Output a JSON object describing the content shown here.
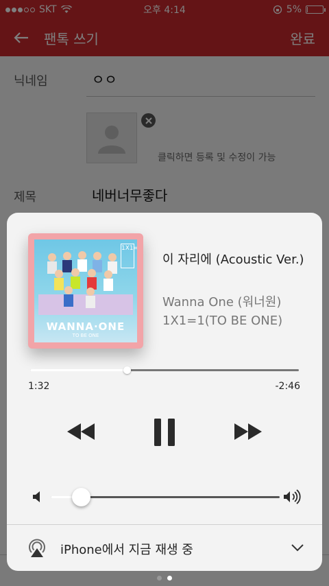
{
  "status_bar": {
    "carrier": "SKT",
    "time": "오후 4:14",
    "battery": "5%",
    "battery_level": 0.05
  },
  "nav": {
    "title": "팬톡 쓰기",
    "done": "완료"
  },
  "form": {
    "nickname_label": "닉네임",
    "nickname_value": "ㅇㅇ",
    "photo_hint": "클릭하면 등록 및 수정이 가능",
    "title_label": "제목",
    "title_value": "네버너무좋다"
  },
  "now_playing": {
    "title": "이 자리에 (Acoustic Ver.)",
    "artist": "Wanna One (워너원)",
    "album": "1X1=1(TO BE ONE)",
    "album_art_logo": "WANNA·ONE",
    "album_art_sub": "TO BE ONE",
    "album_art_tag": "1X1=1",
    "elapsed": "1:32",
    "remaining": "-2:46",
    "progress": 0.36,
    "volume": 0.09,
    "airplay_label": "iPhone에서 지금 재생 중"
  },
  "page_indicator": {
    "count": 2,
    "active": 1
  },
  "icons": {
    "back": "arrow-left-icon",
    "rewind": "rewind-icon",
    "pause": "pause-icon",
    "fast_forward": "fast-forward-icon",
    "volume_low": "volume-low-icon",
    "volume_high": "volume-high-icon",
    "airplay": "airplay-icon",
    "chevron": "chevron-down-icon"
  }
}
